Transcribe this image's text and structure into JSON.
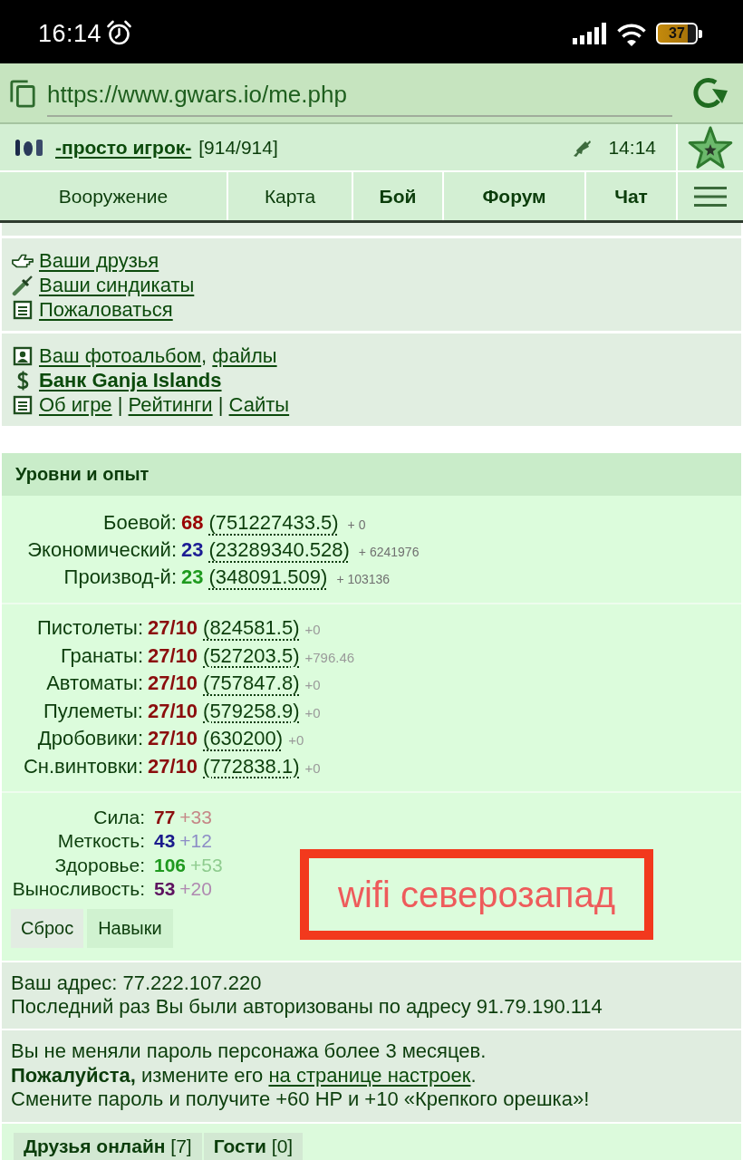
{
  "status_bar": {
    "time": "16:14",
    "battery": "37"
  },
  "browser": {
    "url": "https://www.gwars.io/me.php"
  },
  "header": {
    "player": "-просто игрок-",
    "hp": "[914/914]",
    "time": "14:14",
    "tabs": [
      {
        "label": "Вооружение",
        "highlighted": false
      },
      {
        "label": "Карта",
        "highlighted": false
      },
      {
        "label": "Бой",
        "highlighted": true
      },
      {
        "label": "Форум",
        "highlighted": true
      },
      {
        "label": "Чат",
        "highlighted": true
      }
    ]
  },
  "link_panels": [
    {
      "items": [
        {
          "kind": "hand",
          "links": [
            {
              "text": "Ваши друзья",
              "bold": false
            }
          ]
        },
        {
          "kind": "dagger",
          "links": [
            {
              "text": "Ваши синдикаты",
              "bold": false
            }
          ]
        },
        {
          "kind": "document",
          "links": [
            {
              "text": "Пожаловаться",
              "bold": false
            }
          ]
        }
      ]
    },
    {
      "items": [
        {
          "kind": "portrait",
          "separator": ", ",
          "links": [
            {
              "text": "Ваш фотоальбом",
              "bold": false
            },
            {
              "text": "файлы",
              "bold": false
            }
          ]
        },
        {
          "kind": "dollar",
          "links": [
            {
              "text": "Банк Ganja Islands",
              "bold": true
            }
          ]
        },
        {
          "kind": "document",
          "separator": " | ",
          "links": [
            {
              "text": "Об игре",
              "bold": false
            },
            {
              "text": "Рейтинги",
              "bold": false
            },
            {
              "text": "Сайты",
              "bold": false
            }
          ]
        }
      ]
    }
  ],
  "experience": {
    "title": "Уровни и опыт",
    "levels": [
      {
        "label": "Боевой:",
        "value": "68",
        "color": "#990000",
        "xp": "(751227433.5)",
        "gain": "+ 0"
      },
      {
        "label": "Экономический:",
        "value": "23",
        "color": "#1c1c94",
        "xp": "(23289340.528)",
        "gain": "+ 6241976"
      },
      {
        "label": "Производ-й:",
        "value": "23",
        "color": "#1e9a1e",
        "xp": "(348091.509)",
        "gain": "+ 103136"
      }
    ],
    "skills": [
      {
        "label": "Пистолеты:",
        "value": "27/10",
        "xp": "(824581.5)",
        "gain": "+0"
      },
      {
        "label": "Гранаты:",
        "value": "27/10",
        "xp": "(527203.5)",
        "gain": "+796.46"
      },
      {
        "label": "Автоматы:",
        "value": "27/10",
        "xp": "(757847.8)",
        "gain": "+0"
      },
      {
        "label": "Пулеметы:",
        "value": "27/10",
        "xp": "(579258.9)",
        "gain": "+0"
      },
      {
        "label": "Дробовики:",
        "value": "27/10",
        "xp": "(630200)",
        "gain": "+0"
      },
      {
        "label": "Сн.винтовки:",
        "value": "27/10",
        "xp": "(772838.1)",
        "gain": "+0"
      }
    ],
    "stats": [
      {
        "label": "Сила:",
        "value": "77",
        "bonus": "+33",
        "color": "#8b0f0f"
      },
      {
        "label": "Меткость:",
        "value": "43",
        "bonus": "+12",
        "color": "#1a1a8c"
      },
      {
        "label": "Здоровье:",
        "value": "106",
        "bonus": "+53",
        "color": "#1f991f"
      },
      {
        "label": "Выносливость:",
        "value": "53",
        "bonus": "+20",
        "color": "#5e1260"
      }
    ],
    "buttons": [
      {
        "label": "Сброс",
        "highlighted": false
      },
      {
        "label": "Навыки",
        "highlighted": true
      }
    ]
  },
  "annotation": {
    "text": "wifi северозапад"
  },
  "address": {
    "lines": [
      "Ваш адрес: 77.222.107.220",
      "Последний раз Вы были авторизованы по адресу 91.79.190.114"
    ]
  },
  "notice": {
    "lines": [
      {
        "text": "Вы не меняли пароль персонажа более 3 месяцев."
      },
      {
        "text": "**Пожалуйста,** измените его ",
        "link": "на странице настроек",
        "after": "."
      },
      {
        "text": "Смените пароль и получите +60 HP и +10 «Крепкого орешка»!"
      }
    ]
  },
  "bottom_tabs": [
    {
      "label": "Друзья онлайн",
      "count": "[7]"
    },
    {
      "label": "Гости",
      "count": "[0]"
    }
  ]
}
